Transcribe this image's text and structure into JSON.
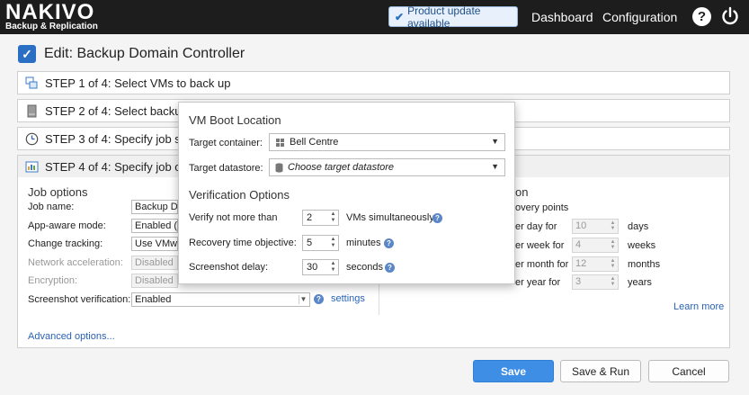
{
  "header": {
    "brand": "NAKIVO",
    "brand_sub": "Backup & Replication",
    "update_label": "Product update available",
    "nav_dashboard": "Dashboard",
    "nav_configuration": "Configuration",
    "help_glyph": "?"
  },
  "page": {
    "title": "Edit: Backup Domain Controller"
  },
  "steps": [
    {
      "label": "STEP 1 of 4: Select VMs to back up"
    },
    {
      "label": "STEP 2 of 4: Select backup"
    },
    {
      "label": "STEP 3 of 4: Specify job s"
    },
    {
      "label": "STEP 4 of 4: Specify job o"
    }
  ],
  "job_options": {
    "title": "Job options",
    "rows": [
      {
        "label": "Job name:",
        "value": "Backup Do",
        "disabled": false
      },
      {
        "label": "App-aware mode:",
        "value": "Enabled (p",
        "disabled": false
      },
      {
        "label": "Change tracking:",
        "value": "Use VMwar",
        "disabled": false
      },
      {
        "label": "Network acceleration:",
        "value": "Disabled",
        "disabled": true
      },
      {
        "label": "Encryption:",
        "value": "Disabled",
        "disabled": true
      },
      {
        "label": "Screenshot verification:",
        "value": "Enabled",
        "disabled": false
      }
    ],
    "settings_link": "settings",
    "advanced_link": "Advanced options..."
  },
  "retention": {
    "title_fragment": "on",
    "recovery_points_fragment": "overy points",
    "rows": [
      {
        "label": "er day for",
        "value": "10",
        "unit": "days"
      },
      {
        "label": "er week for",
        "value": "4",
        "unit": "weeks"
      },
      {
        "label": "er month for",
        "value": "12",
        "unit": "months"
      },
      {
        "label": "er year for",
        "value": "3",
        "unit": "years"
      }
    ],
    "learn_more": "Learn more"
  },
  "popup": {
    "boot_title": "VM Boot Location",
    "target_container_label": "Target container:",
    "target_container_value": "Bell Centre",
    "target_datastore_label": "Target datastore:",
    "target_datastore_placeholder": "Choose target datastore",
    "verification_title": "Verification Options",
    "verify_label": "Verify not more than",
    "verify_value": "2",
    "verify_suffix": "VMs simultaneously",
    "rto_label": "Recovery time objective:",
    "rto_value": "5",
    "rto_suffix": "minutes",
    "screenshot_delay_label": "Screenshot delay:",
    "screenshot_delay_value": "30",
    "screenshot_delay_suffix": "seconds"
  },
  "buttons": {
    "save": "Save",
    "save_run": "Save & Run",
    "cancel": "Cancel"
  },
  "colors": {
    "topbar": "#1d1d1d",
    "accent": "#3e8ee6",
    "link": "#2a62b5"
  }
}
